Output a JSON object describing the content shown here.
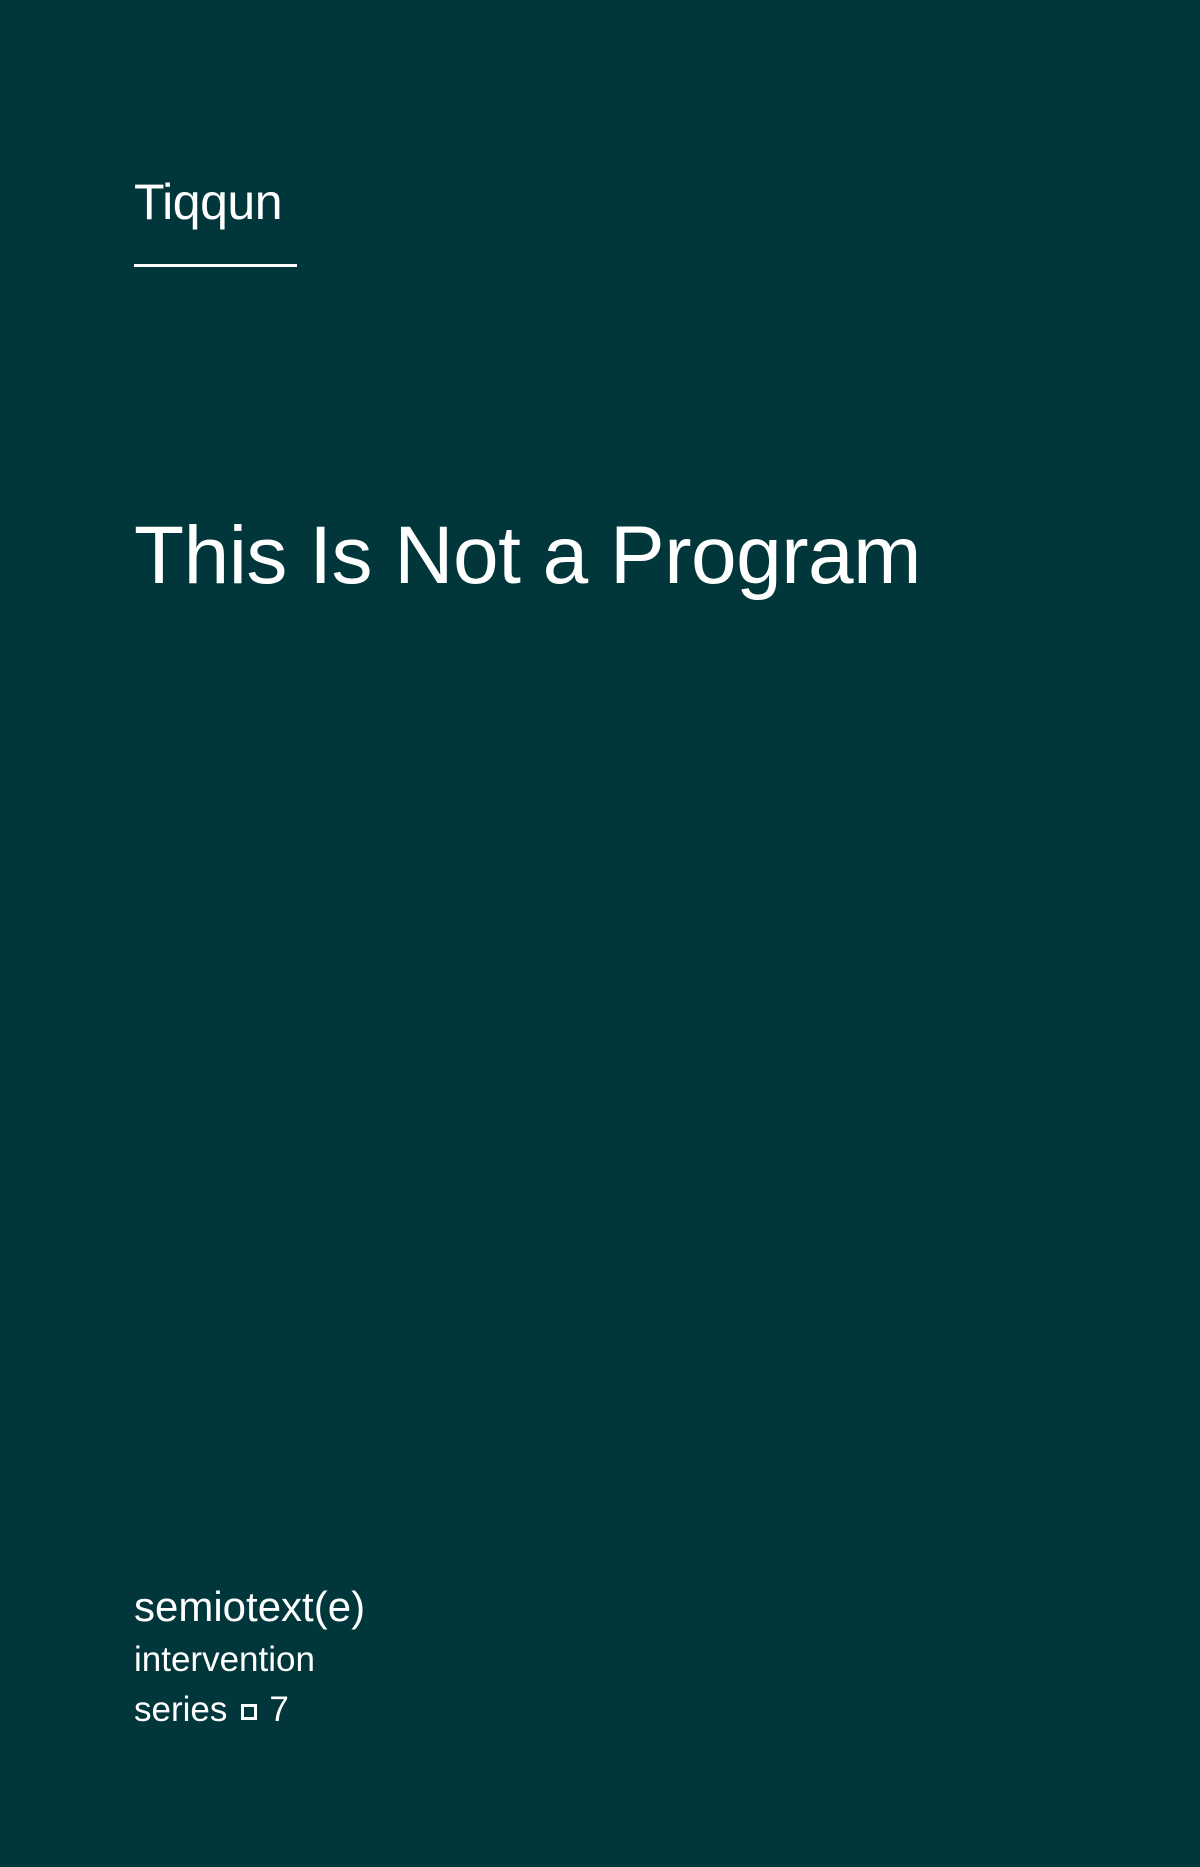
{
  "cover": {
    "background_color": "#01373a",
    "text_color": "#ffffff",
    "author": "Tiqqun",
    "title": "This Is Not a Program",
    "publisher": {
      "name": "semiotext(e)",
      "series_line": "intervention",
      "series_label": "series",
      "series_separator_icon": "hollow-square-icon",
      "series_number": "7"
    }
  }
}
